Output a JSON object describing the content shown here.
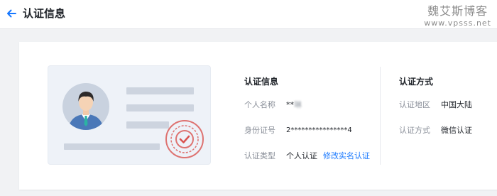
{
  "header": {
    "title": "认证信息",
    "back_icon": "arrow-left-icon",
    "accent": "#1677ff"
  },
  "watermark": {
    "cn": "魏艾斯博客",
    "url": "www.vpsss.net"
  },
  "auth_info": {
    "title": "认证信息",
    "rows": [
      {
        "label": "个人名称",
        "value": "**",
        "value_blurred": "琳"
      },
      {
        "label": "身份证号",
        "value": "2****************4"
      },
      {
        "label": "认证类型",
        "value": "个人认证",
        "link": "修改实名认证"
      }
    ]
  },
  "auth_method": {
    "title": "认证方式",
    "rows": [
      {
        "label": "认证地区",
        "value": "中国大陆"
      },
      {
        "label": "认证方式",
        "value": "微信认证"
      }
    ]
  },
  "illustration": {
    "avatar_icon": "person-avatar-icon",
    "seal_icon": "verified-seal-icon",
    "seal_color": "#d9534f"
  }
}
